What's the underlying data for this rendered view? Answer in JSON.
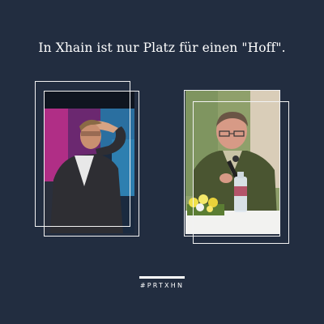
{
  "headline": "In Xhain ist nur Platz für einen \"Hoff\".",
  "hashtag": "#PRTXHN",
  "colors": {
    "background": "#222d40",
    "frame": "#f2f2f2"
  },
  "images": {
    "left": "man on stage shading eyes, dark suit, magenta background",
    "right": "man with glasses speaking into microphone at table with flowers and water bottle"
  }
}
